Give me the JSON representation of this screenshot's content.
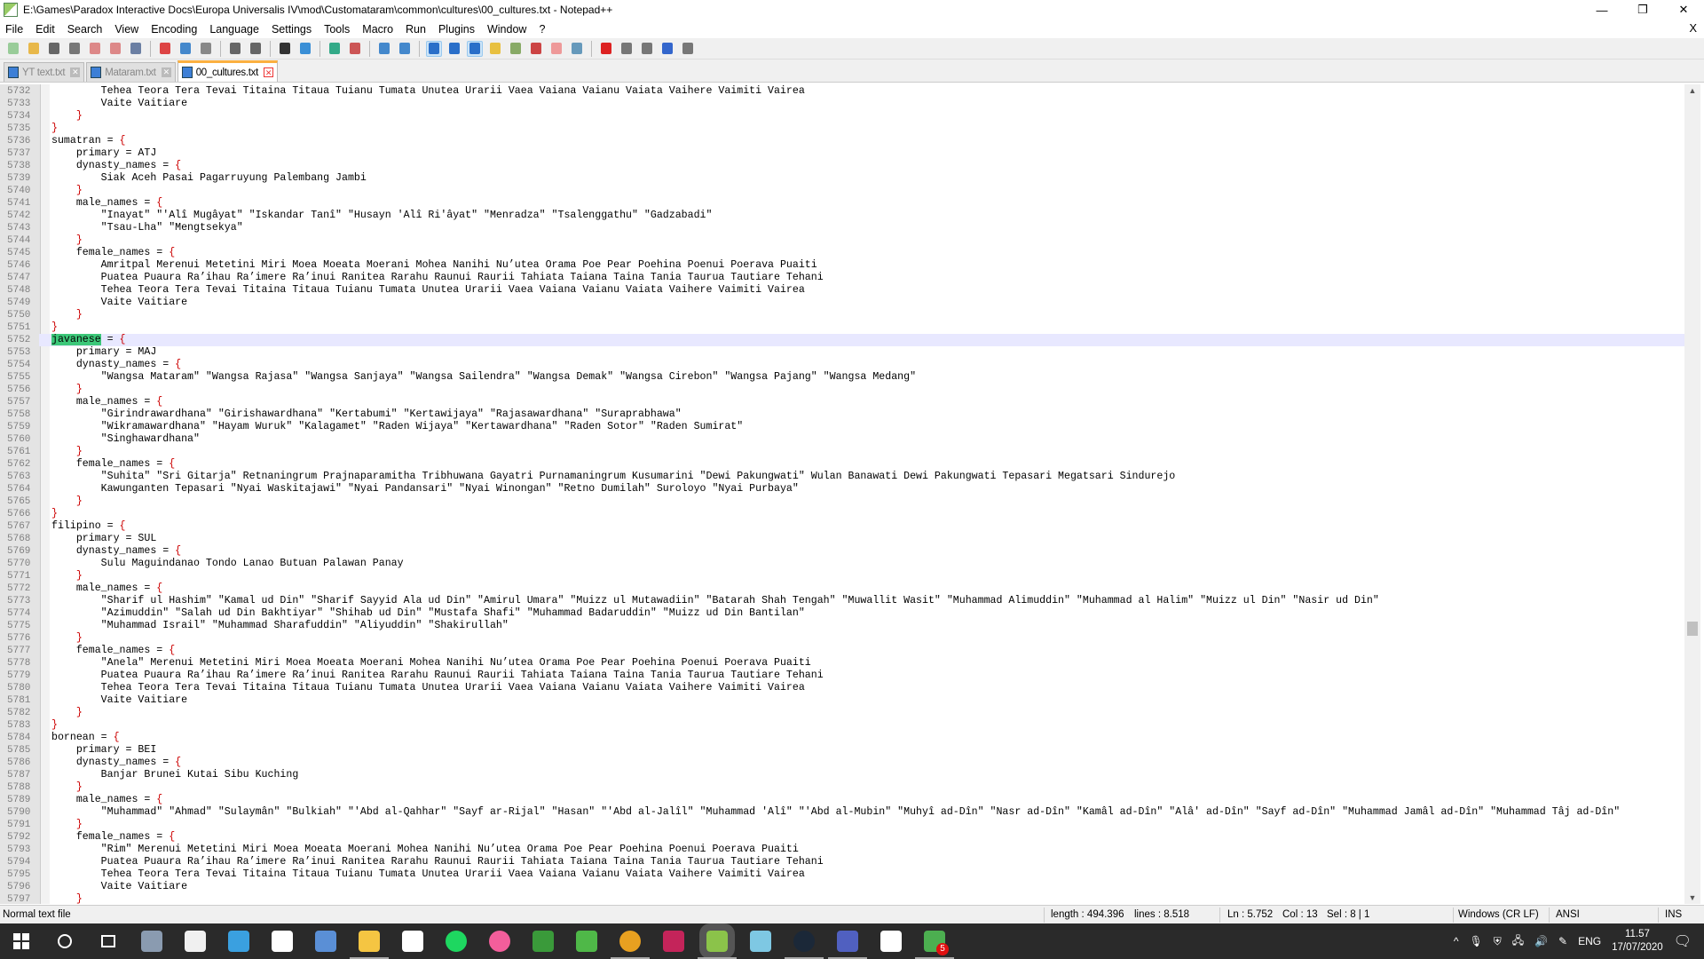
{
  "window": {
    "title": "E:\\Games\\Paradox Interactive Docs\\Europa Universalis IV\\mod\\Customataram\\common\\cultures\\00_cultures.txt - Notepad++",
    "minimize": "—",
    "maximize": "❐",
    "close": "✕"
  },
  "menu": {
    "items": [
      "File",
      "Edit",
      "Search",
      "View",
      "Encoding",
      "Language",
      "Settings",
      "Tools",
      "Macro",
      "Run",
      "Plugins",
      "Window",
      "?"
    ],
    "close_doc": "X"
  },
  "toolbar": {
    "icons": [
      "new-file",
      "open-file",
      "save",
      "save-all",
      "close",
      "close-all",
      "print",
      "cut",
      "copy",
      "paste",
      "undo",
      "redo",
      "find",
      "replace",
      "zoom-in",
      "zoom-out",
      "sync-vertical",
      "sync-horizontal",
      "word-wrap",
      "show-all-chars",
      "indent-guide",
      "udl",
      "doc-map",
      "function-list",
      "folder-as-workspace",
      "monitoring",
      "record-macro",
      "stop-macro",
      "play-macro",
      "run-macro-multiple",
      "save-macro"
    ],
    "active": [
      "word-wrap",
      "indent-guide"
    ]
  },
  "tabs": [
    {
      "label": "YT text.txt",
      "active": false
    },
    {
      "label": "Mataram.txt",
      "active": false
    },
    {
      "label": "00_cultures.txt",
      "active": true
    }
  ],
  "editor": {
    "first_line": 5732,
    "current_line": 5752,
    "selected_word": "javanese",
    "lines": [
      "            Tehea Teora Tera Tevai Titaina Titaua Tuianu Tumata Unutea Urarii Vaea Vaiana Vaianu Vaiata Vaihere Vaimiti Vairea",
      "            Vaite Vaitiare",
      "        }",
      "    }",
      "    sumatran = {",
      "        primary = ATJ",
      "        dynasty_names = {",
      "            Siak Aceh Pasai Pagarruyung Palembang Jambi",
      "        }",
      "        male_names = {",
      "            \"Inayat\" \"'Alî Mugâyat\" \"Iskandar Tanî\" \"Husayn 'Alî Ri'âyat\" \"Menradza\" \"Tsalenggathu\" \"Gadzabadi\"",
      "            \"Tsau-Lha\" \"Mengtsekya\"",
      "        }",
      "        female_names = {",
      "            Amritpal Merenui Metetini Miri Moea Moeata Moerani Mohea Nanihi Nu’utea Orama Poe Pear Poehina Poenui Poerava Puaiti",
      "            Puatea Puaura Ra’ihau Ra’imere Ra’inui Ranitea Rarahu Raunui Raurii Tahiata Taiana Taina Tania Taurua Tautiare Tehani",
      "            Tehea Teora Tera Tevai Titaina Titaua Tuianu Tumata Unutea Urarii Vaea Vaiana Vaianu Vaiata Vaihere Vaimiti Vairea",
      "            Vaite Vaitiare",
      "        }",
      "    }",
      "    javanese = {",
      "        primary = MAJ",
      "        dynasty_names = {",
      "            \"Wangsa Mataram\" \"Wangsa Rajasa\" \"Wangsa Sanjaya\" \"Wangsa Sailendra\" \"Wangsa Demak\" \"Wangsa Cirebon\" \"Wangsa Pajang\" \"Wangsa Medang\"",
      "        }",
      "        male_names = {",
      "            \"Girindrawardhana\" \"Girishawardhana\" \"Kertabumi\" \"Kertawijaya\" \"Rajasawardhana\" \"Suraprabhawa\"",
      "            \"Wikramawardhana\" \"Hayam Wuruk\" \"Kalagamet\" \"Raden Wijaya\" \"Kertawardhana\" \"Raden Sotor\" \"Raden Sumirat\"",
      "            \"Singhawardhana\"",
      "        }",
      "        female_names = {",
      "            \"Suhita\" \"Sri Gitarja\" Retnaningrum Prajnaparamitha Tribhuwana Gayatri Purnamaningrum Kusumarini \"Dewi Pakungwati\" Wulan Banawati Dewi Pakungwati Tepasari Megatsari Sindurejo",
      "            Kawunganten Tepasari \"Nyai Waskitajawi\" \"Nyai Pandansari\" \"Nyai Winongan\" \"Retno Dumilah\" Suroloyo \"Nyai Purbaya\"",
      "        }",
      "    }",
      "    filipino = {",
      "        primary = SUL",
      "        dynasty_names = {",
      "            Sulu Maguindanao Tondo Lanao Butuan Palawan Panay",
      "        }",
      "        male_names = {",
      "            \"Sharif ul Hashim\" \"Kamal ud Din\" \"Sharif Sayyid Ala ud Din\" \"Amirul Umara\" \"Muizz ul Mutawadiin\" \"Batarah Shah Tengah\" \"Muwallit Wasit\" \"Muhammad Alimuddin\" \"Muhammad al Halim\" \"Muizz ul Din\" \"Nasir ud Din\"",
      "            \"Azimuddin\" \"Salah ud Din Bakhtiyar\" \"Shihab ud Din\" \"Mustafa Shafi\" \"Muhammad Badaruddin\" \"Muizz ud Din Bantilan\"",
      "            \"Muhammad Israil\" \"Muhammad Sharafuddin\" \"Aliyuddin\" \"Shakirullah\"",
      "        }",
      "        female_names = {",
      "            \"Anela\" Merenui Metetini Miri Moea Moeata Moerani Mohea Nanihi Nu’utea Orama Poe Pear Poehina Poenui Poerava Puaiti",
      "            Puatea Puaura Ra’ihau Ra’imere Ra’inui Ranitea Rarahu Raunui Raurii Tahiata Taiana Taina Tania Taurua Tautiare Tehani",
      "            Tehea Teora Tera Tevai Titaina Titaua Tuianu Tumata Unutea Urarii Vaea Vaiana Vaianu Vaiata Vaihere Vaimiti Vairea",
      "            Vaite Vaitiare",
      "        }",
      "    }",
      "    bornean = {",
      "        primary = BEI",
      "        dynasty_names = {",
      "            Banjar Brunei Kutai Sibu Kuching",
      "        }",
      "        male_names = {",
      "            \"Muhammad\" \"Ahmad\" \"Sulaymân\" \"Bulkiah\" \"'Abd al-Qahhar\" \"Sayf ar-Rijal\" \"Hasan\" \"'Abd al-Jalîl\" \"Muhammad 'Alî\" \"'Abd al-Mubin\" \"Muhyî ad-Dîn\" \"Nasr ad-Dîn\" \"Kamâl ad-Dîn\" \"Alâ' ad-Dîn\" \"Sayf ad-Dîn\" \"Muhammad Jamâl ad-Dîn\" \"Muhammad Tâj ad-Dîn\"",
      "        }",
      "        female_names = {",
      "            \"Rim\" Merenui Metetini Miri Moea Moeata Moerani Mohea Nanihi Nu’utea Orama Poe Pear Poehina Poenui Poerava Puaiti",
      "            Puatea Puaura Ra’ihau Ra’imere Ra’inui Ranitea Rarahu Raunui Raurii Tahiata Taiana Taina Tania Taurua Tautiare Tehani",
      "            Tehea Teora Tera Tevai Titaina Titaua Tuianu Tumata Unutea Urarii Vaea Vaiana Vaianu Vaiata Vaihere Vaimiti Vairea",
      "            Vaite Vaitiare",
      "        }"
    ]
  },
  "status": {
    "file_type": "Normal text file",
    "length": "length : 494.396",
    "lines": "lines : 8.518",
    "ln": "Ln : 5.752",
    "col": "Col : 13",
    "sel": "Sel : 8 | 1",
    "eol": "Windows (CR LF)",
    "encoding": "ANSI",
    "mode": "INS"
  },
  "taskbar": {
    "apps": [
      {
        "name": "start",
        "color": "#ffffff"
      },
      {
        "name": "search",
        "color": "#ffffff"
      },
      {
        "name": "task-view",
        "color": "#ffffff"
      },
      {
        "name": "app-generic",
        "color": "#8a9bb0"
      },
      {
        "name": "microsoft-store",
        "color": "#f0f0f0"
      },
      {
        "name": "app-blue",
        "color": "#3aa0e0"
      },
      {
        "name": "security",
        "color": "#ffffff"
      },
      {
        "name": "calculator",
        "color": "#5a8fd6"
      },
      {
        "name": "file-explorer",
        "color": "#f5c542"
      },
      {
        "name": "calendar-app",
        "color": "#ffffff"
      },
      {
        "name": "spotify",
        "color": "#1ed760"
      },
      {
        "name": "itunes",
        "color": "#f35e9b"
      },
      {
        "name": "app-green-blue",
        "color": "#3a9a3a"
      },
      {
        "name": "utorrent",
        "color": "#4fb848"
      },
      {
        "name": "chrome",
        "color": "#e8a020"
      },
      {
        "name": "app-red",
        "color": "#c4245a"
      },
      {
        "name": "notepad-plus-plus",
        "color": "#8bc34a"
      },
      {
        "name": "app-cyan",
        "color": "#7ec8e3"
      },
      {
        "name": "steam",
        "color": "#1b2838"
      },
      {
        "name": "app-paint",
        "color": "#5060c0"
      },
      {
        "name": "app-mountain",
        "color": "#ffffff"
      },
      {
        "name": "app-notify",
        "color": "#4caf50",
        "badge": "5"
      }
    ],
    "tray": {
      "chevron": "^",
      "language": "ENG",
      "time": "11.57",
      "date": "17/07/2020"
    }
  }
}
